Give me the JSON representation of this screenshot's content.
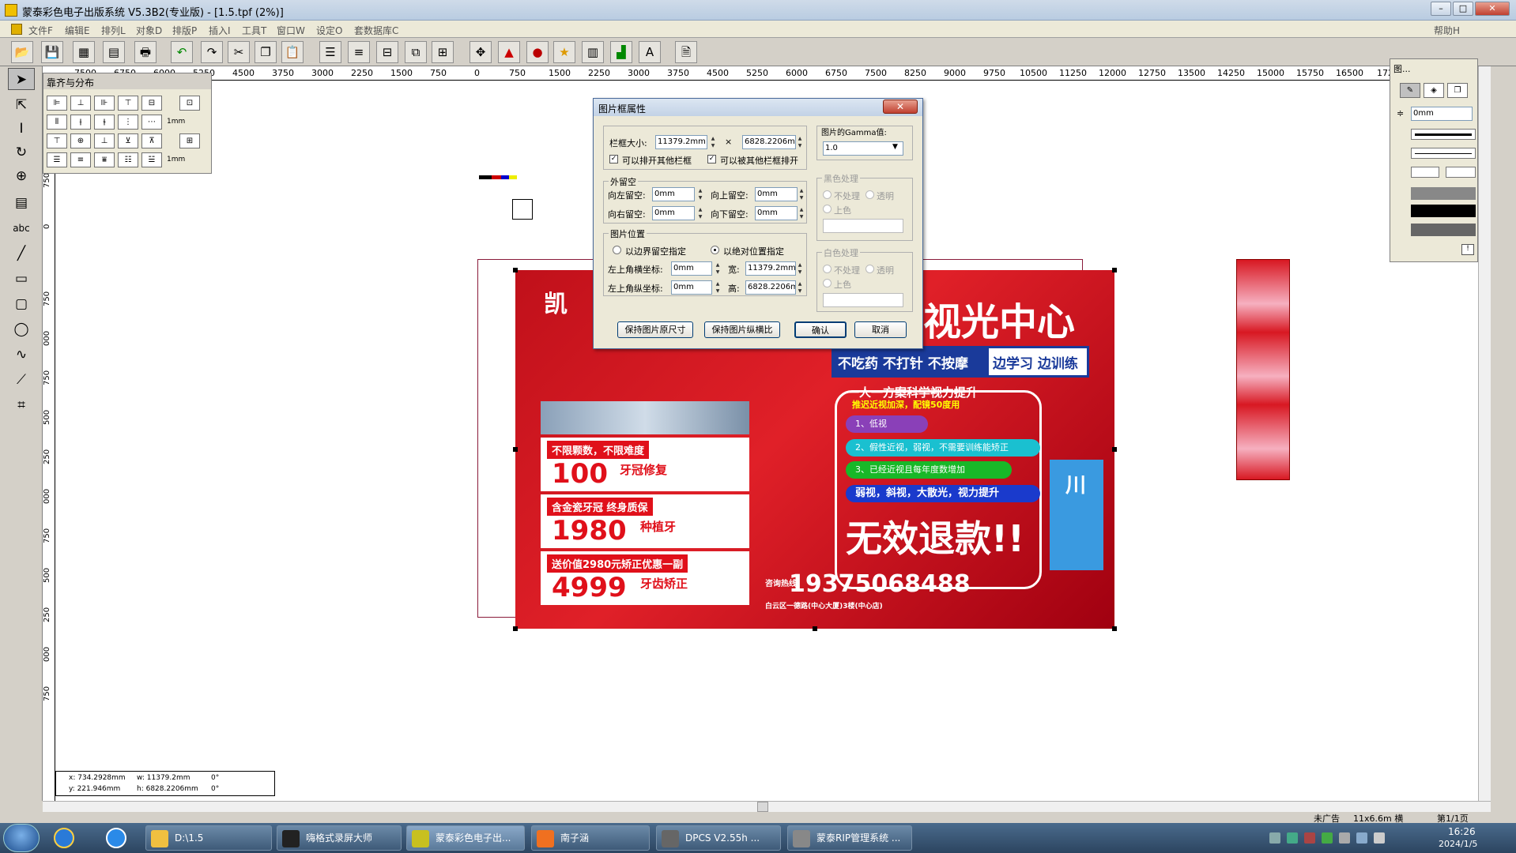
{
  "window": {
    "title": "蒙泰彩色电子出版系统 V5.3B2(专业版) - [1.5.tpf (2%)]",
    "min": "–",
    "max": "□",
    "close": "✕"
  },
  "menu": [
    "文件F",
    "编辑E",
    "排列L",
    "对象D",
    "排版P",
    "插入I",
    "工具T",
    "窗口W",
    "设定O",
    "套数据库C"
  ],
  "menu_help": "帮助H",
  "ruler_h": [
    "7500",
    "6750",
    "6000",
    "5250",
    "4500",
    "3750",
    "3000",
    "2250",
    "1500",
    "750",
    "0",
    "750",
    "1500",
    "2250",
    "3000",
    "3750",
    "4500",
    "5250",
    "6000",
    "6750",
    "7500",
    "8250",
    "9000",
    "9750",
    "10500",
    "11250",
    "12000",
    "12750",
    "13500",
    "14250",
    "15000",
    "15750",
    "16500",
    "172"
  ],
  "ruler_v": [
    "750",
    "0",
    "750",
    "000",
    "750",
    "500",
    "250",
    "000",
    "750",
    "500",
    "250",
    "000",
    "750"
  ],
  "align_palette": {
    "title": "靠齐与分布",
    "unit1": "1mm",
    "unit2": "1mm"
  },
  "dialog": {
    "title": "图片框属性",
    "close": "✕",
    "frame_size_label": "栏框大小:",
    "width_value": "11379.2mm",
    "times": "×",
    "height_value": "6828.2206mm",
    "chk_push_others": "可以排开其他栏框",
    "chk_pushed_by": "可以被其他栏框排开",
    "margin_group": "外留空",
    "left_margin_label": "向左留空:",
    "left_margin": "0mm",
    "top_margin_label": "向上留空:",
    "top_margin": "0mm",
    "right_margin_label": "向右留空:",
    "right_margin": "0mm",
    "bottom_margin_label": "向下留空:",
    "bottom_margin": "0mm",
    "pos_group": "图片位置",
    "radio_border": "以边界留空指定",
    "radio_absolute": "以绝对位置指定",
    "x_label": "左上角横坐标:",
    "x_value": "0mm",
    "w_label": "宽:",
    "w_value": "11379.2mm",
    "y_label": "左上角纵坐标:",
    "y_value": "0mm",
    "h_label": "高:",
    "h_value": "6828.2206m",
    "gamma_group": "图片的Gamma值:",
    "gamma_value": "1.0",
    "black_group": "黑色处理",
    "black_none": "不处理",
    "black_transparent": "透明",
    "black_color": "上色",
    "white_group": "白色处理",
    "white_none": "不处理",
    "white_transparent": "透明",
    "white_color": "上色",
    "btn_keep_size": "保持图片原尺寸",
    "btn_keep_ratio": "保持图片纵横比",
    "btn_ok": "确认",
    "btn_cancel": "取消"
  },
  "prop_panel": {
    "title": "图...",
    "indent": "0mm"
  },
  "poster": {
    "headline": "视光中心",
    "bar_left": "不吃药 不打针 不按摩",
    "bar_right": "边学习 边训练",
    "subtitle": "一人一方案科学视力提升",
    "subtitle2": "推迟近视加深，配镜50度用",
    "pills": [
      "1、低视",
      "2、假性近视，弱视，不需要训练能矫正",
      "3、已经近视且每年度数增加",
      "弱视，斜视，大散光，视力提升"
    ],
    "refund": "无效退款!!",
    "phone_label": "咨询热线",
    "phone": "19375068488",
    "address": "白云区一德路(中心大厦)3楼(中心店)",
    "side_text": "川",
    "cards": [
      {
        "head": "不限颗数，不限难度",
        "big": "100",
        "small": "牙冠修复"
      },
      {
        "head": "含金瓷牙冠 终身质保",
        "big": "1980",
        "small": "种植牙"
      },
      {
        "head": "送价值2980元矫正优惠一副",
        "big": "4999",
        "small": "牙齿矫正"
      }
    ],
    "logo": "凯"
  },
  "coords": {
    "x": "x: 734.2928mm",
    "y": "y: 221.946mm",
    "w": "w: 11379.2mm",
    "h": "h: 6828.2206mm",
    "rot": "0°",
    "skew": "0°"
  },
  "status": {
    "left": "未广告",
    "size": "11x6.6m 横",
    "page": "第1/1页"
  },
  "taskbar": {
    "items": [
      "D:\\1.5",
      "嗨格式录屏大师",
      "蒙泰彩色电子出...",
      "南子涵",
      "DPCS      V2.55h ...",
      "蒙泰RIP管理系统 ..."
    ],
    "time": "16:26",
    "date": "2024/1/5"
  },
  "colors": {
    "poster_red": "#d81822",
    "accent_blue": "#1a3a9a",
    "title_bg": "#c2d2e6"
  }
}
